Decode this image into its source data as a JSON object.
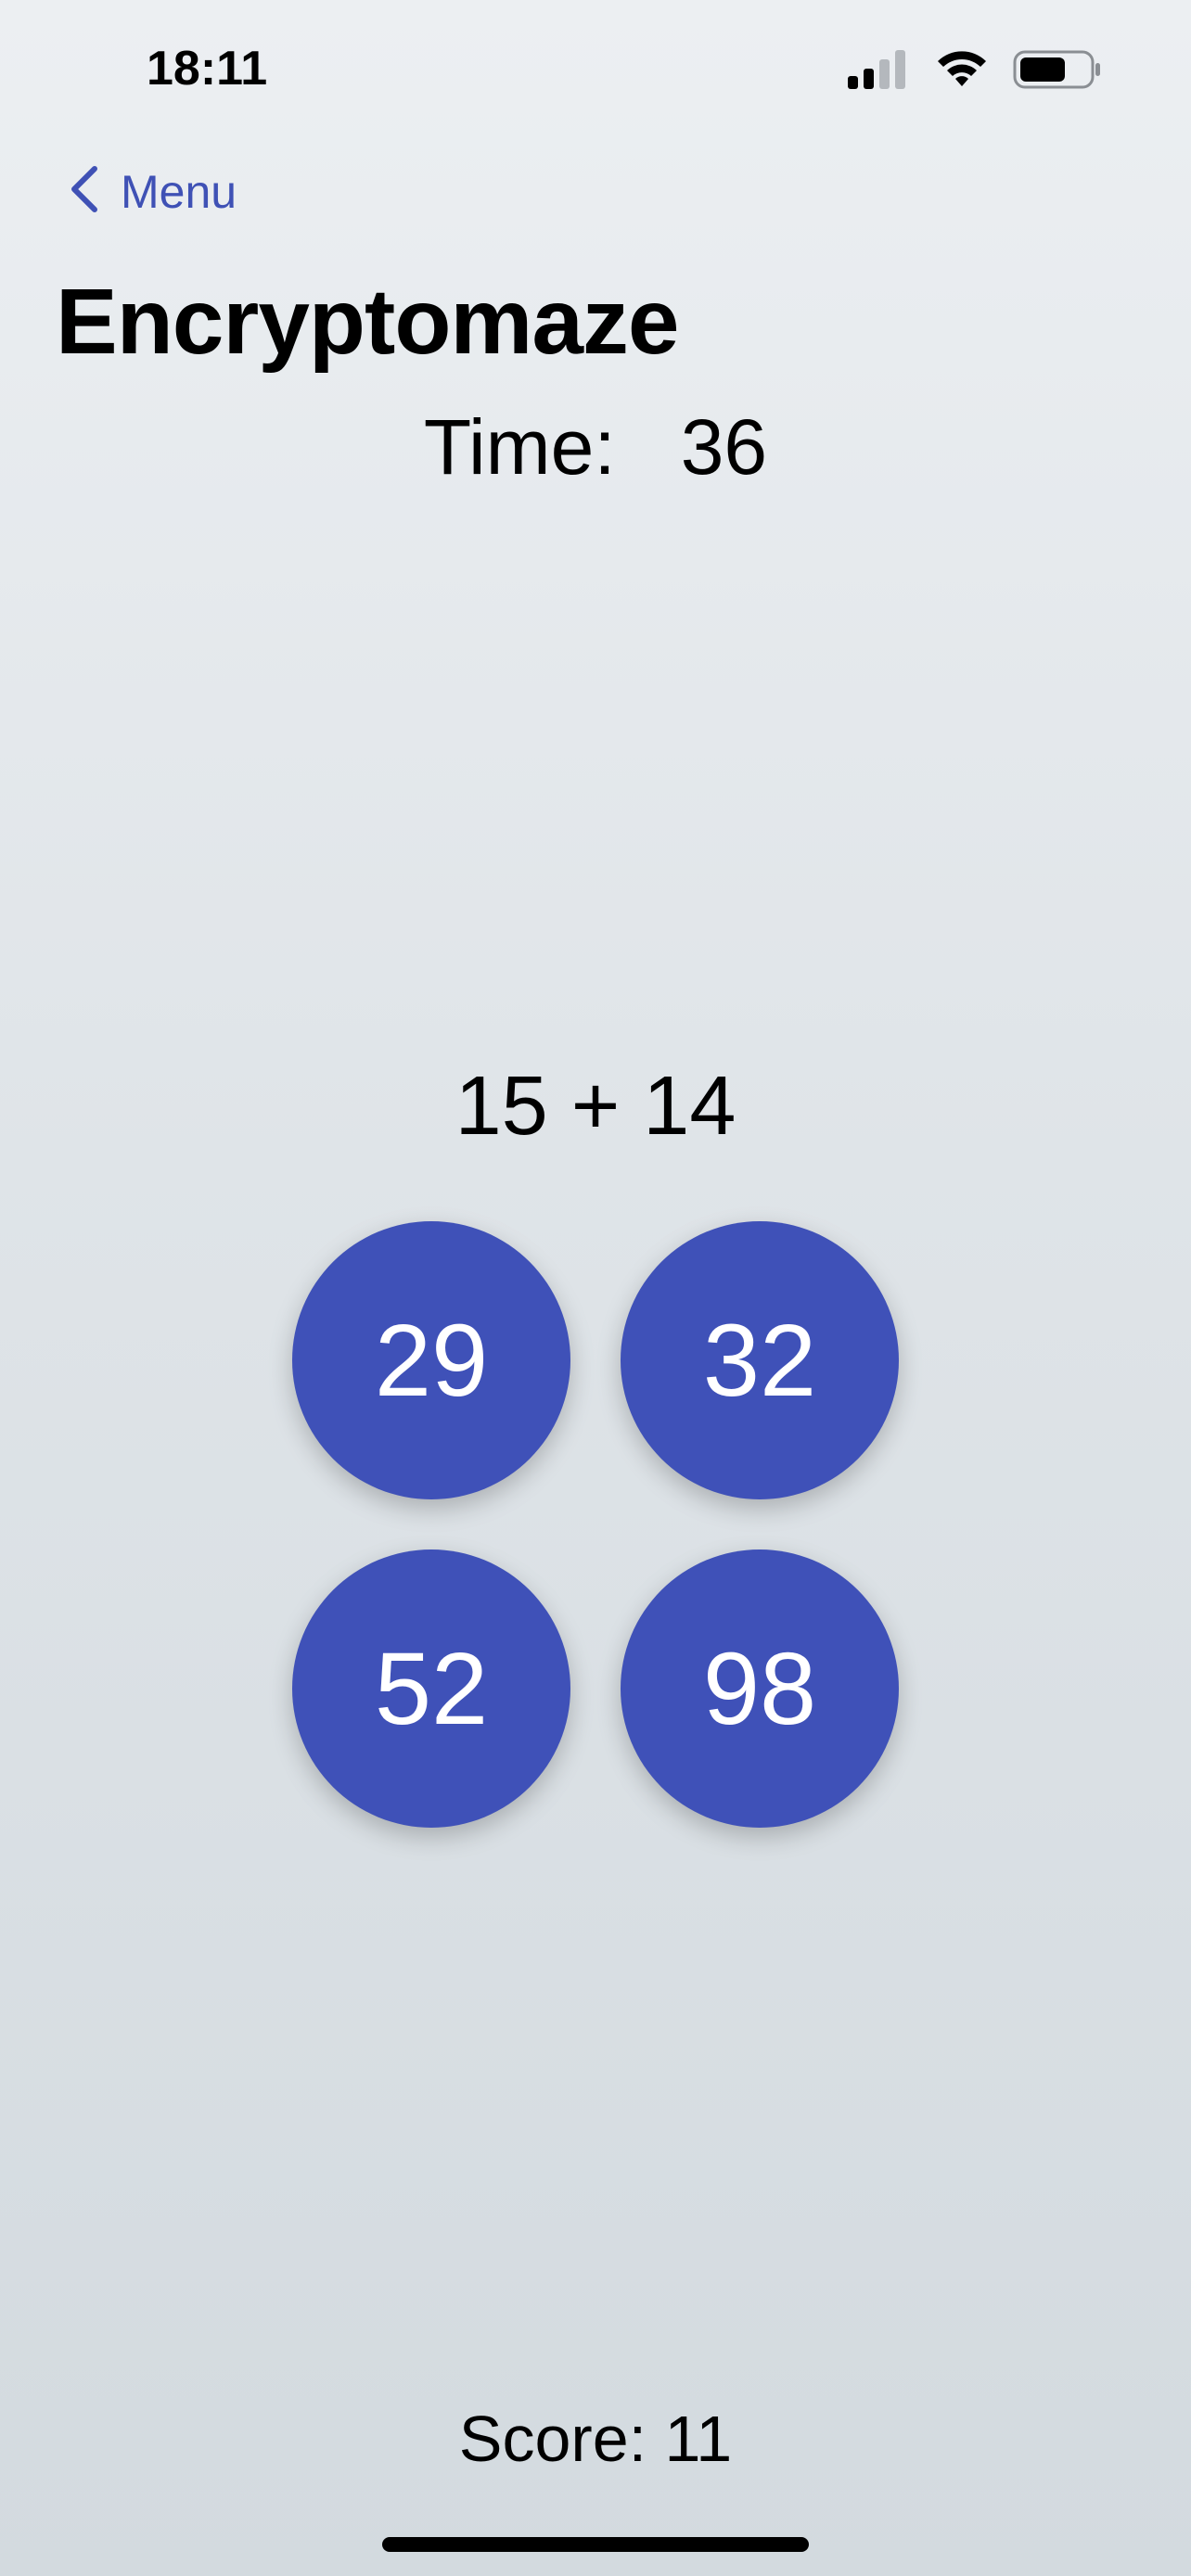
{
  "status_bar": {
    "time": "18:11",
    "icons": [
      "cellular-signal-icon",
      "wifi-icon",
      "battery-icon"
    ]
  },
  "nav": {
    "back_label": "Menu",
    "back_icon": "chevron-left-icon"
  },
  "page": {
    "title": "Encryptomaze"
  },
  "timer": {
    "label": "Time:",
    "value": "36"
  },
  "question": {
    "equation": "15 + 14"
  },
  "answers": [
    "29",
    "32",
    "52",
    "98"
  ],
  "score": {
    "text": "Score: 11"
  },
  "colors": {
    "accent": "#3f51b5",
    "answer_button": "#3f51b8",
    "text": "#000000"
  }
}
